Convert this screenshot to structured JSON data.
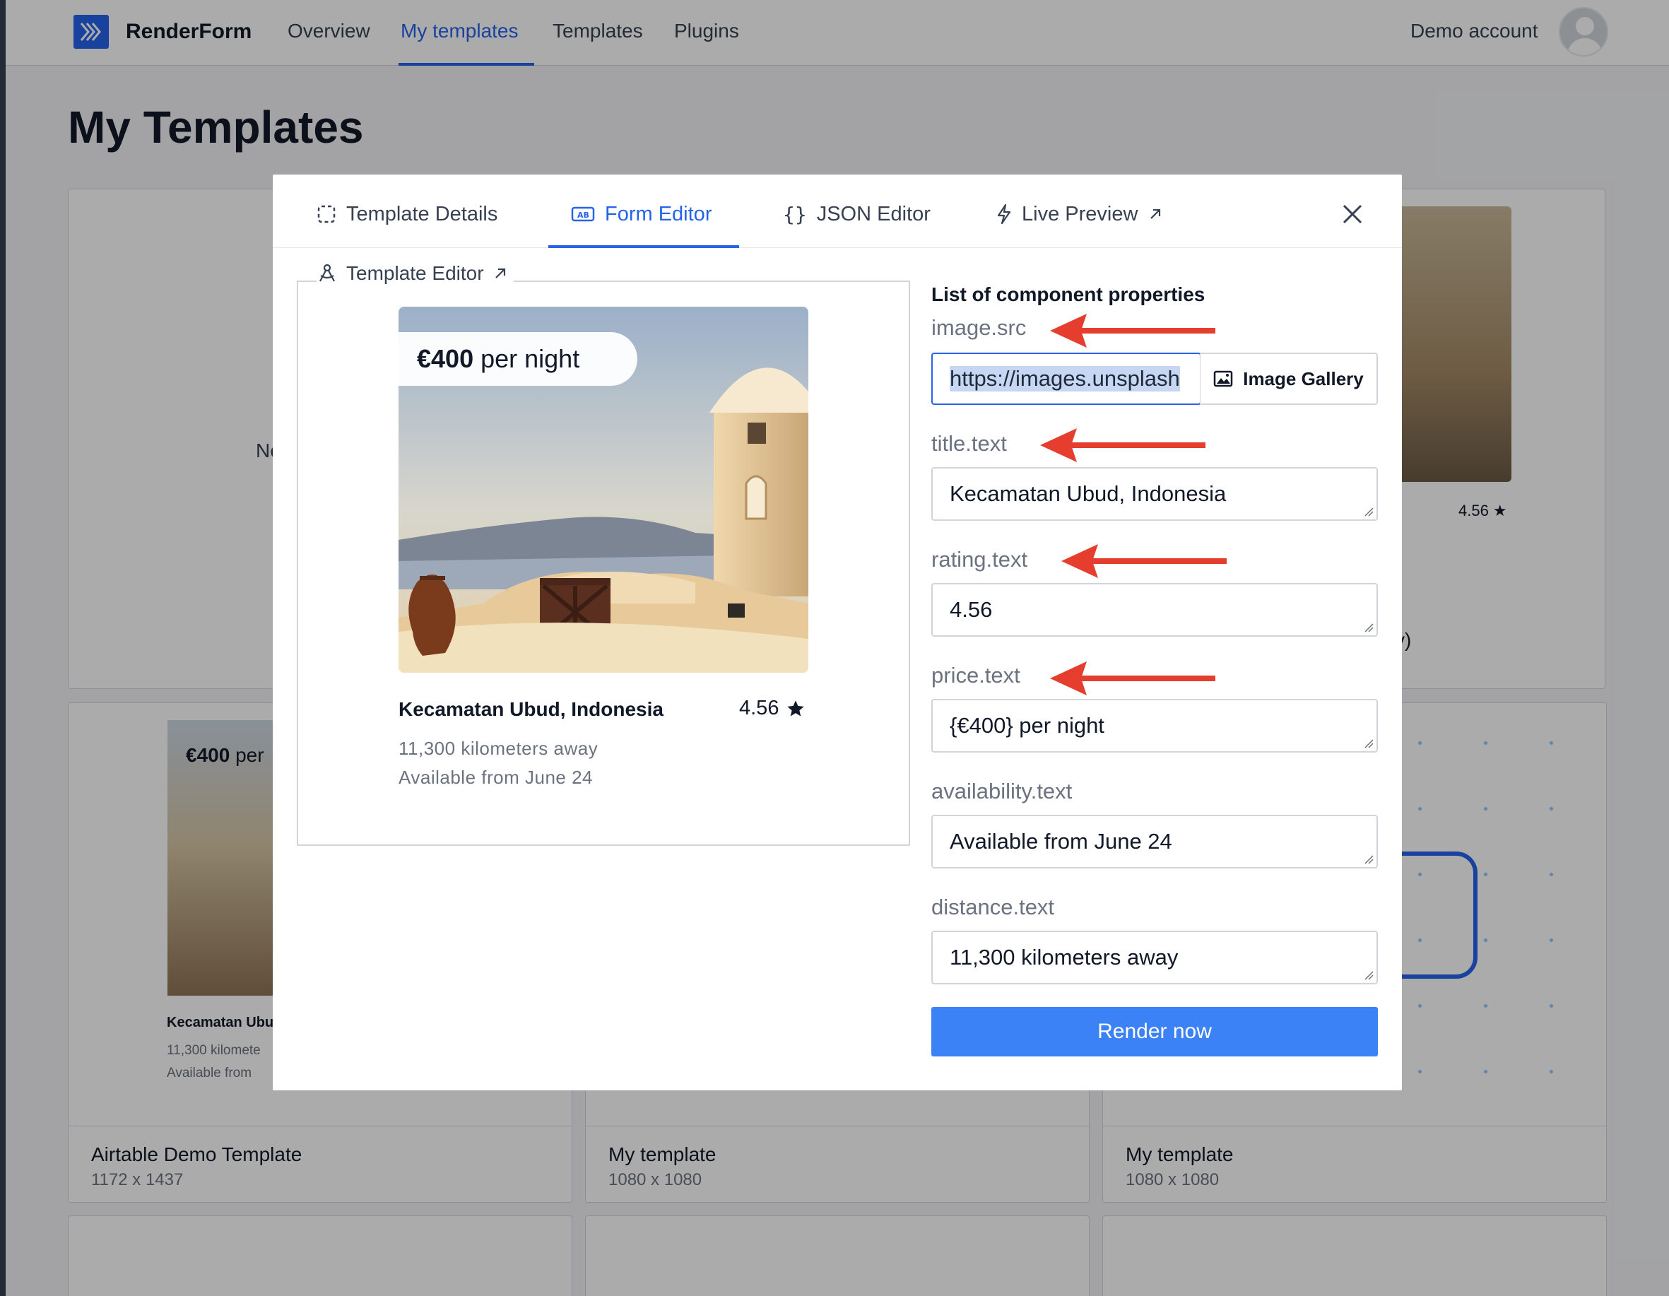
{
  "app": {
    "brand": "RenderForm",
    "nav": [
      "Overview",
      "My templates",
      "Templates",
      "Plugins"
    ],
    "active_nav": "My templates",
    "account": "Demo account"
  },
  "page": {
    "title": "My Templates",
    "cards": [
      {
        "name": "Airtable Demo Template",
        "size": "1172 x 1437"
      },
      {
        "name": "My template",
        "size": "1080 x 1080"
      },
      {
        "name": "My template",
        "size": "1080 x 1080"
      }
    ],
    "partial_text": {
      "left": "Ne",
      "right_suffix": "y)",
      "right_rating": "4.56"
    },
    "mini_card": {
      "price_bold": "€400",
      "price_rest": " per",
      "title": "Kecamatan Ubu",
      "distance": "11,300 kilomete",
      "availability": "Available from"
    }
  },
  "modal": {
    "tabs": [
      {
        "label": "Template Details",
        "icon": "dashed-square-icon"
      },
      {
        "label": "Form Editor",
        "icon": "ab-field-icon"
      },
      {
        "label": "JSON Editor",
        "icon": "braces-icon"
      },
      {
        "label": "Live Preview",
        "icon": "lightning-icon"
      }
    ],
    "active_tab": "Form Editor",
    "template_editor_link": "Template Editor",
    "preview": {
      "price_bold": "€400",
      "price_rest": "per night",
      "title": "Kecamatan Ubud, Indonesia",
      "rating": "4.56",
      "distance": "11,300 kilometers away",
      "availability": "Available from June 24"
    },
    "form": {
      "heading": "List of component properties",
      "fields": [
        {
          "label": "image.src",
          "value": "https://images.unsplash"
        },
        {
          "label": "title.text",
          "value": "Kecamatan Ubud, Indonesia"
        },
        {
          "label": "rating.text",
          "value": "4.56"
        },
        {
          "label": "price.text",
          "value": "{€400} per night"
        },
        {
          "label": "availability.text",
          "value": "Available from June 24"
        },
        {
          "label": "distance.text",
          "value": "11,300 kilometers away"
        }
      ],
      "gallery_button": "Image Gallery",
      "submit": "Render now"
    }
  },
  "colors": {
    "accent": "#2563eb",
    "button": "#3b82f6",
    "annotation_arrow": "#e53e2e"
  }
}
